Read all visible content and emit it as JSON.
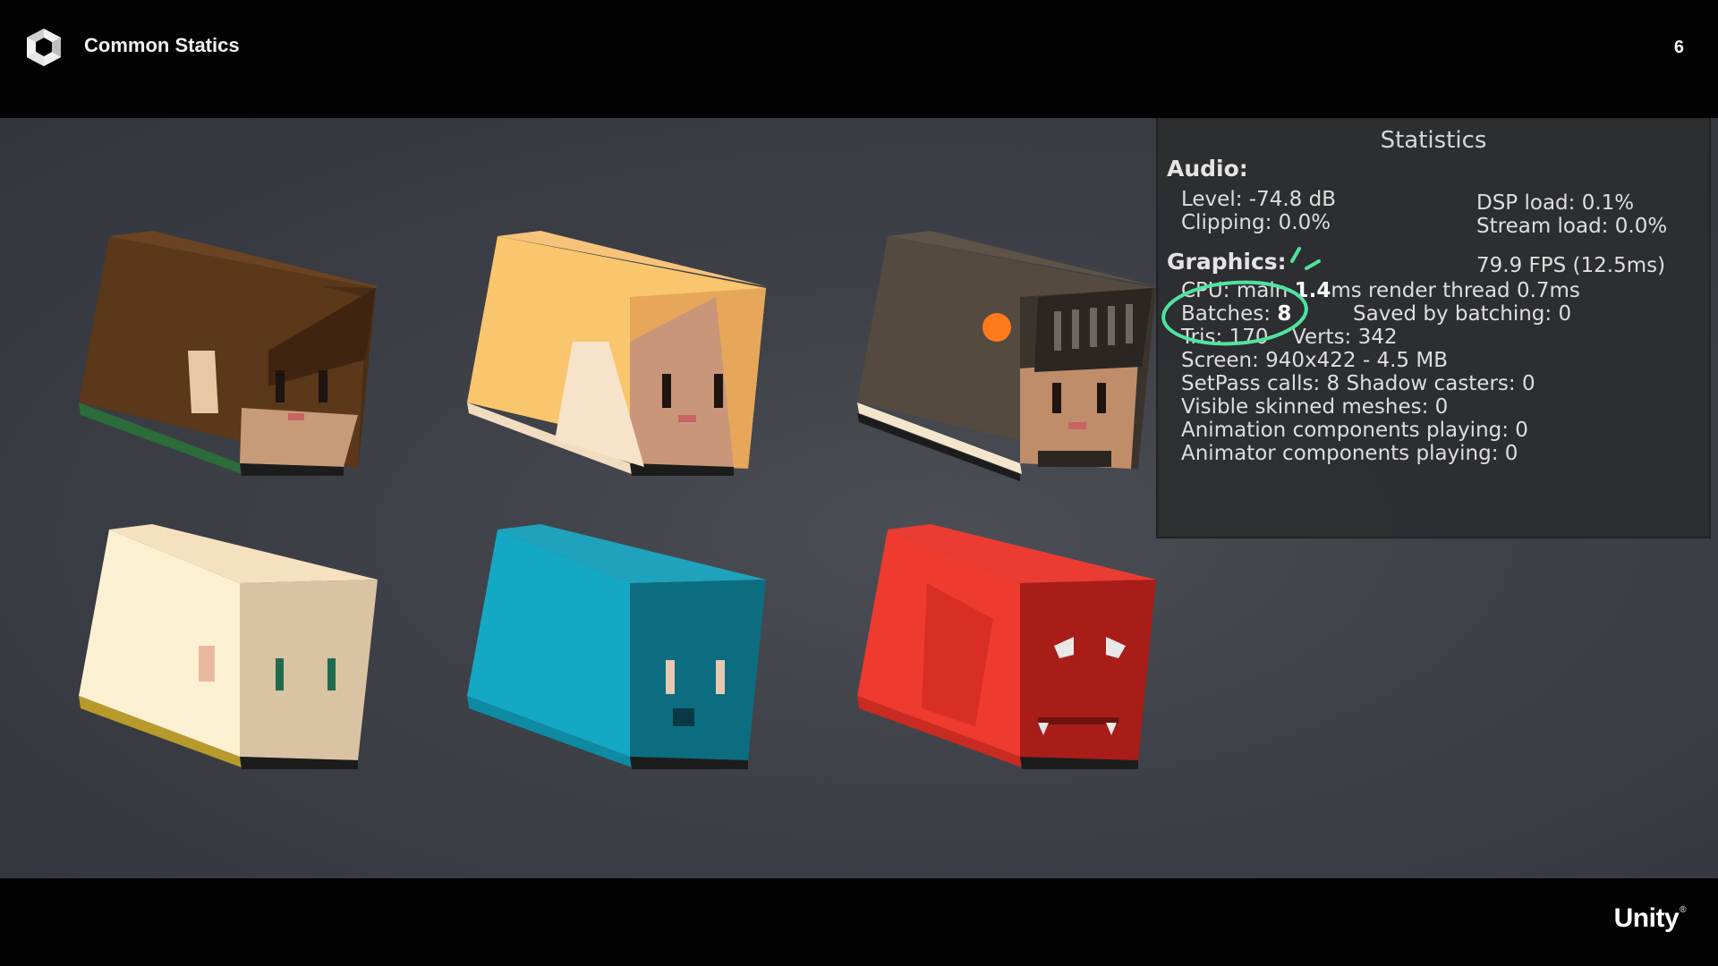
{
  "header": {
    "title": "Common Statics",
    "page_number": "6",
    "logo_icon": "unity-cube-logo-icon"
  },
  "scene": {
    "background": "#3d4047",
    "cubes": [
      {
        "name": "brown-hair-cube",
        "top": "#6a4422",
        "left": "#5a3819",
        "right": "#4a2d14",
        "face": "#c79b78"
      },
      {
        "name": "blonde-hair-cube",
        "top": "#f7c27a",
        "left": "#f9c66d",
        "right": "#e6a75a",
        "face": "#c9967a"
      },
      {
        "name": "helmet-cube",
        "top": "#5e5347",
        "left": "#544a3f",
        "right": "#3b342d",
        "face": "#c08d6b"
      },
      {
        "name": "cream-cube",
        "top": "#f5e1c0",
        "left": "#fbf0d2",
        "right": "#d9c3a2",
        "face": "#d9c3a2"
      },
      {
        "name": "teal-cube",
        "top": "#1fa3bc",
        "left": "#15a8c4",
        "right": "#0d6d80",
        "face": "#0d6d80"
      },
      {
        "name": "red-cube",
        "top": "#ea3c32",
        "left": "#ef3a30",
        "right": "#a81d18",
        "face": "#a81d18"
      }
    ]
  },
  "stats": {
    "title": "Statistics",
    "audio_header": "Audio:",
    "level": "Level: -74.8 dB",
    "clipping": "Clipping: 0.0%",
    "dsp_load": "DSP load: 0.1%",
    "stream_load": "Stream load: 0.0%",
    "graphics_header": "Graphics:",
    "fps": "79.9 FPS (12.5ms)",
    "cpu_prefix": "CPU: main ",
    "cpu_main_value": "1.4",
    "cpu_suffix": "ms  render thread 0.7ms",
    "batches_label": "Batches: ",
    "batches_value": "8",
    "saved_batching": "Saved by batching: 0",
    "tris": "Tris: 170",
    "verts": "Verts: 342",
    "screen": "Screen: 940x422 - 4.5 MB",
    "setpass": "SetPass calls: 8 Shadow casters: 0",
    "skinned": "Visible skinned meshes: 0",
    "animation": "Animation components playing: 0",
    "animator": "Animator components playing: 0",
    "annotation_color": "#4fe3a0"
  },
  "footer": {
    "brand": "Unity",
    "brand_mark": "®"
  }
}
